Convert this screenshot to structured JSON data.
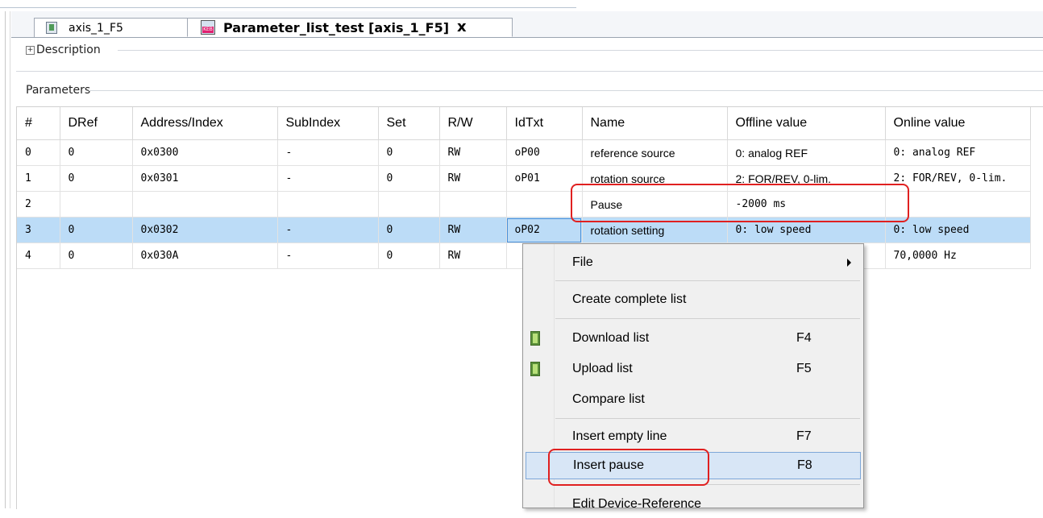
{
  "tabs": [
    {
      "label": "axis_1_F5",
      "icon": "axis-device-icon"
    },
    {
      "label": "Parameter_list_test [axis_1_F5]",
      "icon": "keb-parameter-list-icon",
      "close": "x"
    }
  ],
  "sections": {
    "description": {
      "expander": "+",
      "label": "Description"
    },
    "parameters": {
      "label": "Parameters"
    }
  },
  "table": {
    "columns": [
      "#",
      "DRef",
      "Address/Index",
      "SubIndex",
      "Set",
      "R/W",
      "IdTxt",
      "Name",
      "Offline value",
      "Online value"
    ],
    "rows": [
      [
        "0",
        "0",
        "0x0300",
        "-",
        "0",
        "RW",
        "oP00",
        "reference source",
        "0: analog REF",
        "0: analog REF"
      ],
      [
        "1",
        "0",
        "0x0301",
        "-",
        "0",
        "RW",
        "oP01",
        "rotation source",
        "2: FOR/REV, 0-lim.",
        "2: FOR/REV, 0-lim."
      ],
      [
        "2",
        "",
        "",
        "",
        "",
        "",
        "",
        "Pause",
        "-2000 ms",
        ""
      ],
      [
        "3",
        "0",
        "0x0302",
        "-",
        "0",
        "RW",
        "oP02",
        "rotation setting",
        "0: low speed",
        "0: low speed"
      ],
      [
        "4",
        "0",
        "0x030A",
        "-",
        "0",
        "RW",
        "",
        "",
        "",
        "70,0000 Hz"
      ]
    ],
    "selected_row": 3
  },
  "context_menu": {
    "items": [
      {
        "label": "File",
        "key": "",
        "submenu": true
      },
      {
        "label": "Create complete list",
        "key": ""
      },
      {
        "label": "Download list",
        "key": "F4",
        "icon": "download-arrow-icon"
      },
      {
        "label": "Upload list",
        "key": "F5",
        "icon": "upload-arrow-icon"
      },
      {
        "label": "Compare list",
        "key": ""
      },
      {
        "label": "Insert empty line",
        "key": "F7"
      },
      {
        "label": "Insert pause",
        "key": "F8"
      },
      {
        "label": "Edit Device-Reference",
        "key": ""
      }
    ],
    "highlighted": "Insert pause"
  },
  "colors": {
    "selected_row": "#bcdcf7",
    "menu_hover": "#d8e6f6",
    "annotation_red": "#e02020"
  }
}
